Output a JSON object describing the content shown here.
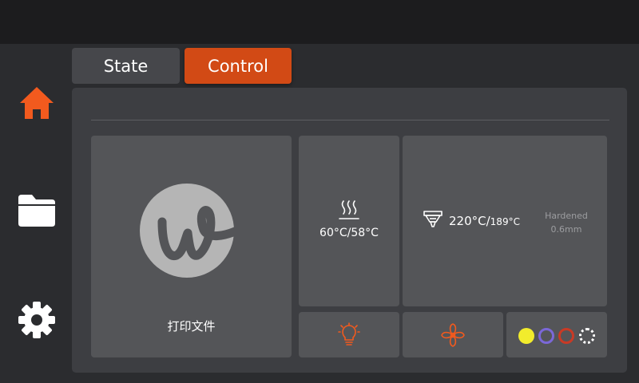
{
  "sidebar": {
    "items": [
      {
        "name": "home",
        "icon": "home-icon",
        "active": true
      },
      {
        "name": "files",
        "icon": "folder-icon",
        "active": false
      },
      {
        "name": "settings",
        "icon": "gear-icon",
        "active": false
      }
    ]
  },
  "tabs": [
    {
      "label": "State",
      "active": false
    },
    {
      "label": "Control",
      "active": true
    }
  ],
  "print_tile": {
    "icon": "brand-logo-icon",
    "label": "打印文件"
  },
  "bed": {
    "icon": "heated-bed-icon",
    "temperature": "60°C/58°C"
  },
  "nozzle": {
    "icon": "nozzle-icon",
    "current": "220°C/",
    "target": "189°C",
    "type_line1": "Hardened",
    "type_line2": "0.6mm"
  },
  "controls": {
    "light_icon": "light-bulb-icon",
    "fan_icon": "fan-icon"
  },
  "filament_slots": [
    {
      "color": "#f2ec2c",
      "style": "filled"
    },
    {
      "color": "#7b68d8",
      "style": "ring"
    },
    {
      "color": "#c93a25",
      "style": "ring"
    },
    {
      "color": "#ffffff",
      "style": "dashed-ring"
    }
  ],
  "colors": {
    "accent": "#d24a15",
    "icon_orange": "#f25a1e",
    "panel": "#3d3e42",
    "tile": "#545558",
    "background": "#2b2c2f"
  }
}
